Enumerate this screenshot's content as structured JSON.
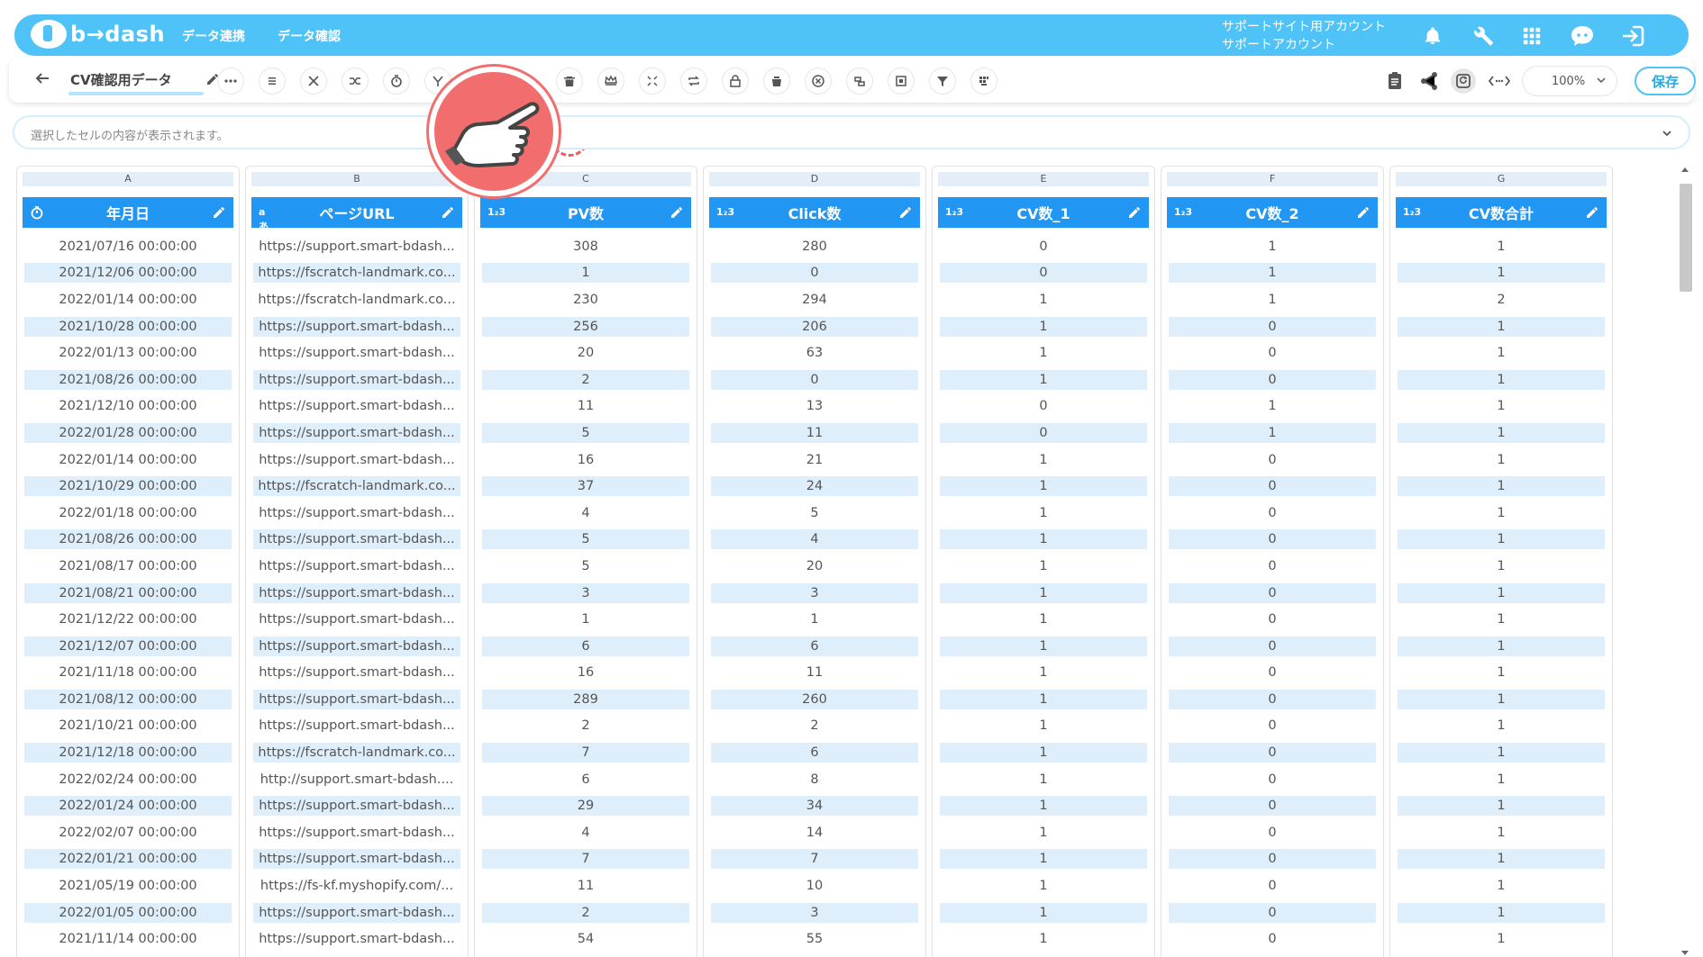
{
  "nav": {
    "logo": "b→dash",
    "links": [
      "データ連携",
      "データ確認"
    ],
    "account_line1": "サポートサイト用アカウント",
    "account_line2": "サポートアカウント",
    "icons": [
      "bell-icon",
      "wrench-icon",
      "grid-icon",
      "chat-icon",
      "logout-icon"
    ]
  },
  "toolbar": {
    "sheet_title": "CV確認用データ",
    "zoom": "100%",
    "save_label": "保存"
  },
  "cellbar": {
    "placeholder": "選択したセルの内容が表示されます。"
  },
  "colors": {
    "nav_bg": "#4fc3f7",
    "header_bg": "#2196f3",
    "stripe": "#deeefa",
    "pointer": "#f26d6d"
  },
  "columns": [
    {
      "letter": "A",
      "name": "年月日",
      "type_icon": "clock-icon",
      "cells": [
        "2021/07/16 00:00:00",
        "2021/12/06 00:00:00",
        "2022/01/14 00:00:00",
        "2021/10/28 00:00:00",
        "2022/01/13 00:00:00",
        "2021/08/26 00:00:00",
        "2021/12/10 00:00:00",
        "2022/01/28 00:00:00",
        "2022/01/14 00:00:00",
        "2021/10/29 00:00:00",
        "2022/01/18 00:00:00",
        "2021/08/26 00:00:00",
        "2021/08/17 00:00:00",
        "2021/08/21 00:00:00",
        "2021/12/22 00:00:00",
        "2021/12/07 00:00:00",
        "2021/11/18 00:00:00",
        "2021/08/12 00:00:00",
        "2021/10/21 00:00:00",
        "2021/12/18 00:00:00",
        "2022/02/24 00:00:00",
        "2022/01/24 00:00:00",
        "2022/02/07 00:00:00",
        "2022/01/21 00:00:00",
        "2021/05/19 00:00:00",
        "2022/01/05 00:00:00",
        "2021/11/14 00:00:00"
      ]
    },
    {
      "letter": "B",
      "name": "ページURL",
      "type_icon": "text-icon",
      "cells": [
        "https://support.smart-bdash...",
        "https://fscratch-landmark.co...",
        "https://fscratch-landmark.co...",
        "https://support.smart-bdash...",
        "https://support.smart-bdash...",
        "https://support.smart-bdash...",
        "https://support.smart-bdash...",
        "https://support.smart-bdash...",
        "https://support.smart-bdash...",
        "https://fscratch-landmark.co...",
        "https://support.smart-bdash...",
        "https://support.smart-bdash...",
        "https://support.smart-bdash...",
        "https://support.smart-bdash...",
        "https://support.smart-bdash...",
        "https://support.smart-bdash...",
        "https://support.smart-bdash...",
        "https://support.smart-bdash...",
        "https://support.smart-bdash...",
        "https://fscratch-landmark.co...",
        "http://support.smart-bdash....",
        "https://support.smart-bdash...",
        "https://support.smart-bdash...",
        "https://support.smart-bdash...",
        "https://fs-kf.myshopify.com/...",
        "https://support.smart-bdash...",
        "https://support.smart-bdash..."
      ]
    },
    {
      "letter": "C",
      "name": "PV数",
      "type_icon": "number-icon",
      "cells": [
        "308",
        "1",
        "230",
        "256",
        "20",
        "2",
        "11",
        "5",
        "16",
        "37",
        "4",
        "5",
        "5",
        "3",
        "1",
        "6",
        "16",
        "289",
        "2",
        "7",
        "6",
        "29",
        "4",
        "7",
        "11",
        "2",
        "54"
      ]
    },
    {
      "letter": "D",
      "name": "Click数",
      "type_icon": "number-icon",
      "cells": [
        "280",
        "0",
        "294",
        "206",
        "63",
        "0",
        "13",
        "11",
        "21",
        "24",
        "5",
        "4",
        "20",
        "3",
        "1",
        "6",
        "11",
        "260",
        "2",
        "6",
        "8",
        "34",
        "14",
        "7",
        "10",
        "3",
        "55"
      ]
    },
    {
      "letter": "E",
      "name": "CV数_1",
      "type_icon": "number-icon",
      "cells": [
        "0",
        "0",
        "1",
        "1",
        "1",
        "1",
        "0",
        "0",
        "1",
        "1",
        "1",
        "1",
        "1",
        "1",
        "1",
        "1",
        "1",
        "1",
        "1",
        "1",
        "1",
        "1",
        "1",
        "1",
        "1",
        "1",
        "1"
      ]
    },
    {
      "letter": "F",
      "name": "CV数_2",
      "type_icon": "number-icon",
      "cells": [
        "1",
        "1",
        "1",
        "0",
        "0",
        "0",
        "1",
        "1",
        "0",
        "0",
        "0",
        "0",
        "0",
        "0",
        "0",
        "0",
        "0",
        "0",
        "0",
        "0",
        "0",
        "0",
        "0",
        "0",
        "0",
        "0",
        "0"
      ]
    },
    {
      "letter": "G",
      "name": "CV数合計",
      "type_icon": "number-icon",
      "cells": [
        "1",
        "1",
        "2",
        "1",
        "1",
        "1",
        "1",
        "1",
        "1",
        "1",
        "1",
        "1",
        "1",
        "1",
        "1",
        "1",
        "1",
        "1",
        "1",
        "1",
        "1",
        "1",
        "1",
        "1",
        "1",
        "1",
        "1"
      ]
    }
  ]
}
